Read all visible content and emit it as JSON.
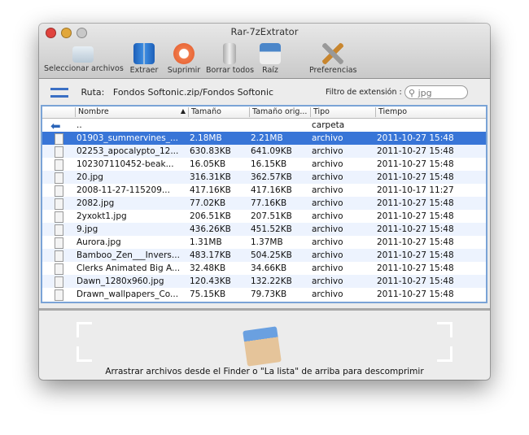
{
  "window": {
    "title": "Rar-7zExtrator"
  },
  "toolbar": [
    {
      "label": "Seleccionar archivos",
      "icon": "folder-icon"
    },
    {
      "label": "Extraer",
      "icon": "extract-zip-icon"
    },
    {
      "label": "Suprimir",
      "icon": "delete-icon"
    },
    {
      "label": "Borrar todos",
      "icon": "trash-icon"
    },
    {
      "label": "Raíz",
      "icon": "home-icon"
    },
    {
      "label": "Preferencias",
      "icon": "tools-icon"
    }
  ],
  "path": {
    "label": "Ruta:",
    "value": "Fondos Softonic.zip/Fondos Softonic"
  },
  "filter": {
    "label": "Filtro de extensión :",
    "value": "jpg"
  },
  "table": {
    "columns": [
      "Nombre",
      "Tamaño",
      "Tamaño orig...",
      "Tipo",
      "Tiempo"
    ],
    "parent": {
      "name": "..",
      "type": "carpeta"
    },
    "rows": [
      [
        "01903_summervines_...",
        "2.18MB",
        "2.21MB",
        "archivo",
        "2011-10-27 15:48"
      ],
      [
        "02253_apocalypto_12...",
        "630.83KB",
        "641.09KB",
        "archivo",
        "2011-10-27 15:48"
      ],
      [
        "102307110452-beak...",
        "16.05KB",
        "16.15KB",
        "archivo",
        "2011-10-27 15:48"
      ],
      [
        "20.jpg",
        "316.31KB",
        "362.57KB",
        "archivo",
        "2011-10-27 15:48"
      ],
      [
        "2008-11-27-115209...",
        "417.16KB",
        "417.16KB",
        "archivo",
        "2011-10-17 11:27"
      ],
      [
        "2082.jpg",
        "77.02KB",
        "77.16KB",
        "archivo",
        "2011-10-27 15:48"
      ],
      [
        "2yxokt1.jpg",
        "206.51KB",
        "207.51KB",
        "archivo",
        "2011-10-27 15:48"
      ],
      [
        "9.jpg",
        "436.26KB",
        "451.52KB",
        "archivo",
        "2011-10-27 15:48"
      ],
      [
        "Aurora.jpg",
        "1.31MB",
        "1.37MB",
        "archivo",
        "2011-10-27 15:48"
      ],
      [
        "Bamboo_Zen___Invers...",
        "483.17KB",
        "504.25KB",
        "archivo",
        "2011-10-27 15:48"
      ],
      [
        "Clerks Animated Big A...",
        "32.48KB",
        "34.66KB",
        "archivo",
        "2011-10-27 15:48"
      ],
      [
        "Dawn_1280x960.jpg",
        "120.43KB",
        "132.22KB",
        "archivo",
        "2011-10-27 15:48"
      ],
      [
        "Drawn_wallpapers_Co...",
        "75.15KB",
        "79.73KB",
        "archivo",
        "2011-10-27 15:48"
      ]
    ],
    "selected_index": 0,
    "sort": "Nombre ascending"
  },
  "dropzone": {
    "message": "Arrastrar archivos desde el Finder o \"La lista\" de arriba para descomprimir"
  },
  "colors": {
    "selection": "#3875d7",
    "table_border": "#7aa3d6"
  }
}
